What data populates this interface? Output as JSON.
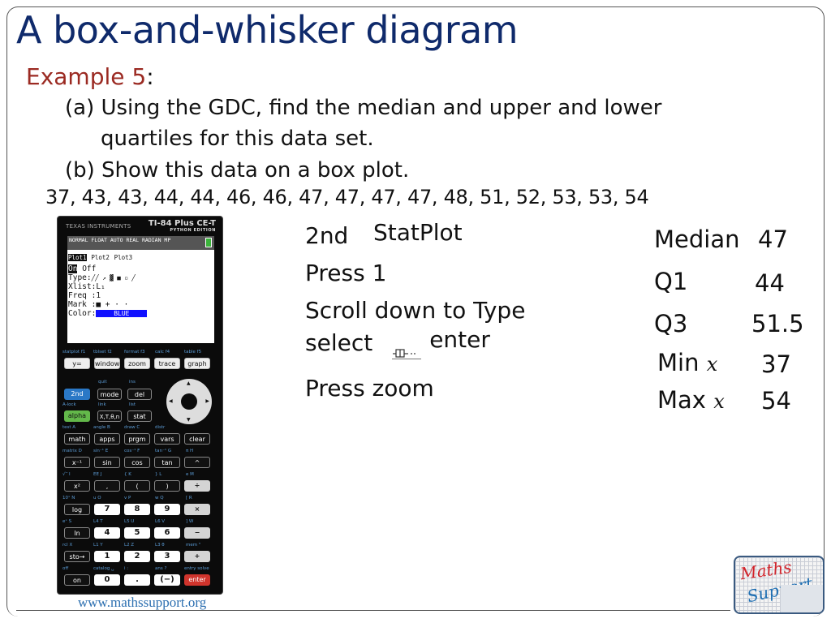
{
  "slide": {
    "title": "A box-and-whisker diagram",
    "example_label": "Example 5",
    "example_colon": ":",
    "question_a_line1": "(a) Using the GDC, find the median and upper and lower",
    "question_a_line2": "quartiles for this data set.",
    "question_b": "(b) Show this data on a box plot.",
    "dataset": "37, 43, 43, 44, 44, 46, 46, 47, 47, 47, 47, 48, 51, 52, 53, 53, 54",
    "website": "www.mathssupport.org",
    "logo": {
      "line1": "Maths",
      "line2": "Support"
    }
  },
  "calculator": {
    "brand": "TEXAS INSTRUMENTS",
    "model": "TI-84 Plus CE-T",
    "edition": "PYTHON EDITION",
    "status_bar": "NORMAL FLOAT AUTO REAL RADIAN MP",
    "screen": {
      "plots": [
        "Plot1",
        "Plot2",
        "Plot3"
      ],
      "on": "On",
      "off": "Off",
      "type_label": "Type:",
      "type_icons": "╱╱ ↗ ▓ ■ ▫ ╱",
      "xlist": "Xlist:L₁",
      "freq": "Freq :1",
      "mark_label": "Mark :",
      "mark_options": "■ + · ·",
      "color_label": "Color:",
      "color_value": "BLUE"
    },
    "fn_labels": [
      "statplot f1",
      "tblset f2",
      "format f3",
      "calc f4",
      "table f5"
    ],
    "keys": {
      "row1": [
        "y=",
        "window",
        "zoom",
        "trace",
        "graph"
      ],
      "second": "2nd",
      "mode": "mode",
      "del": "del",
      "quit": "quit",
      "ins": "ins",
      "alock": "A-lock",
      "link": "link",
      "list": "list",
      "alpha": "alpha",
      "xton": "X,T,θ,n",
      "stat": "stat",
      "row_labels1": [
        "test A",
        "angle B",
        "draw C",
        "distr"
      ],
      "row4": [
        "math",
        "apps",
        "prgm",
        "vars",
        "clear"
      ],
      "row_labels2": [
        "matrix D",
        "sin⁻¹ E",
        "cos⁻¹ F",
        "tan⁻¹ G",
        "π H"
      ],
      "row5": [
        "x⁻¹",
        "sin",
        "cos",
        "tan",
        "^"
      ],
      "row_labels3": [
        "√‾ I",
        "EE J",
        "{ K",
        "} L",
        "e M"
      ],
      "row6": [
        "x²",
        ",",
        "(",
        ")",
        "÷"
      ],
      "row_labels4": [
        "10ˣ N",
        "u O",
        "v P",
        "w Q",
        "[ R"
      ],
      "row7": [
        "log",
        "7",
        "8",
        "9",
        "×"
      ],
      "row_labels5": [
        "eˣ S",
        "L4 T",
        "L5 U",
        "L6 V",
        "] W"
      ],
      "row8": [
        "ln",
        "4",
        "5",
        "6",
        "−"
      ],
      "row_labels6": [
        "rcl X",
        "L1 Y",
        "L2 Z",
        "L3 θ",
        "mem \""
      ],
      "row9": [
        "sto→",
        "1",
        "2",
        "3",
        "+"
      ],
      "row_labels7": [
        "off",
        "catalog ␣",
        "i :",
        "ans ?",
        "entry solve"
      ],
      "row10": [
        "on",
        "0",
        ".",
        "(−)",
        "enter"
      ]
    }
  },
  "instructions": {
    "step1a": "2nd",
    "step1b": "StatPlot",
    "step2": "Press 1",
    "step3": "Scroll down to Type",
    "step4a": "select",
    "step4b": "enter",
    "step5": "Press zoom"
  },
  "stats": {
    "median_label": "Median",
    "median_value": "47",
    "q1_label": "Q1",
    "q1_value": "44",
    "q3_label": "Q3",
    "q3_value": "51.5",
    "min_label": "Min",
    "min_var": "x",
    "min_value": "37",
    "max_label": "Max",
    "max_var": "x",
    "max_value": "54"
  }
}
